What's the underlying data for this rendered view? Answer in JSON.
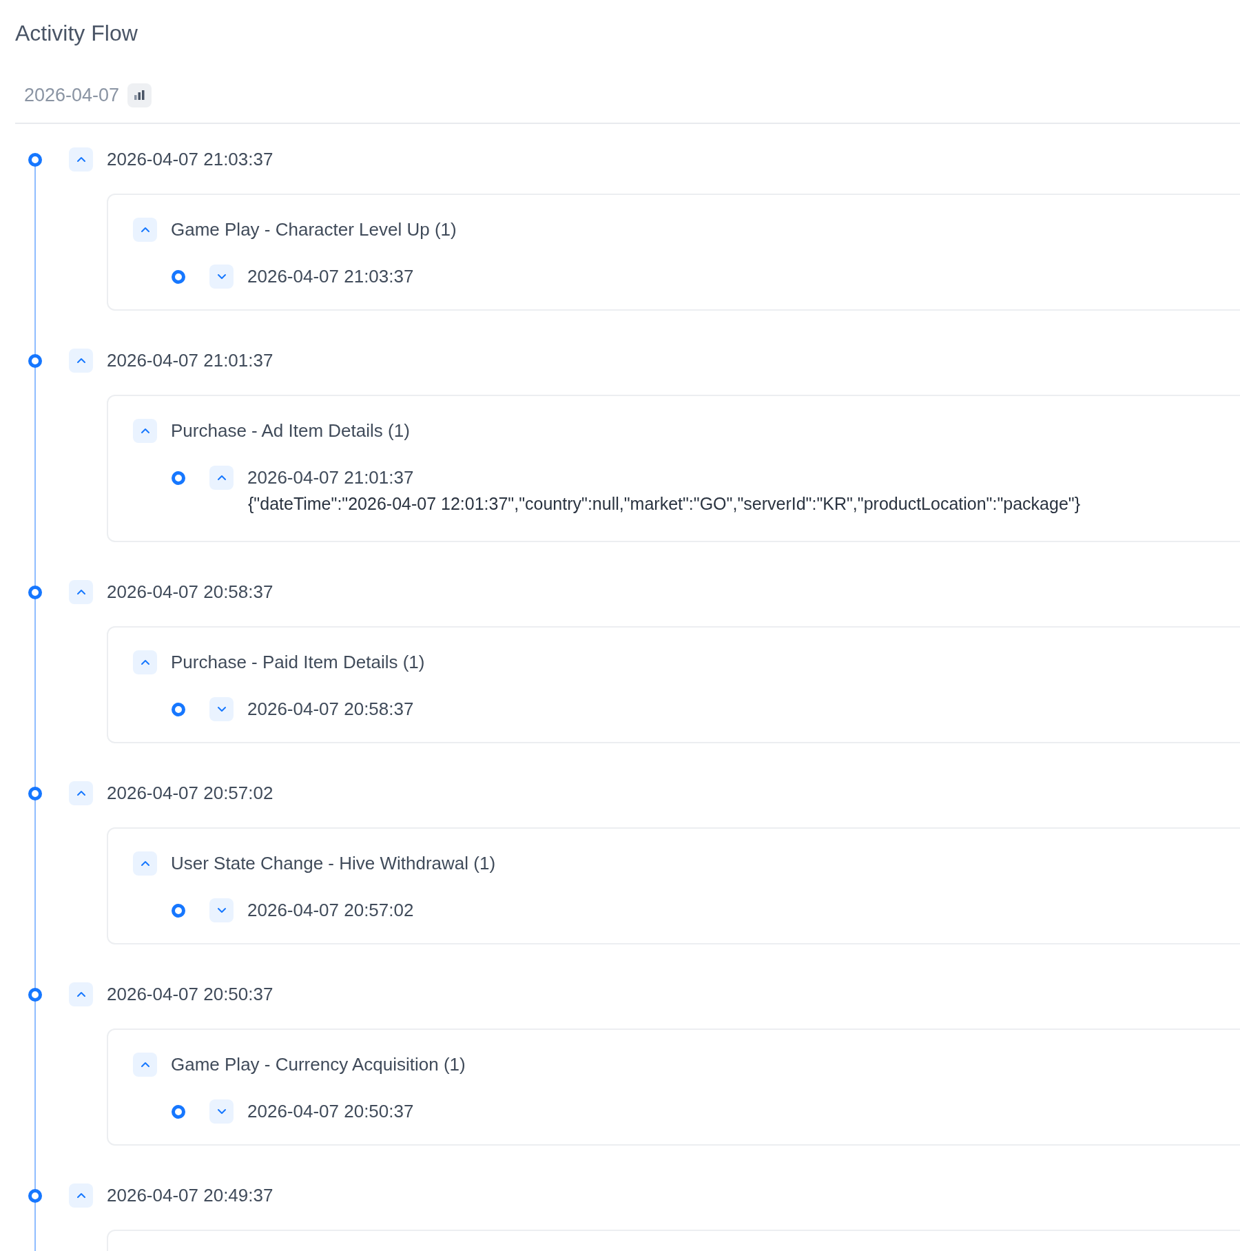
{
  "title": "Activity Flow",
  "date_tab": {
    "label": "2026-04-07"
  },
  "groups": [
    {
      "time": "2026-04-07 21:03:37",
      "expanded": true,
      "events": [
        {
          "name": "Game Play - Character Level Up (1)",
          "expanded": true,
          "entries": [
            {
              "time": "2026-04-07 21:03:37",
              "expanded": false
            }
          ]
        }
      ]
    },
    {
      "time": "2026-04-07 21:01:37",
      "expanded": true,
      "events": [
        {
          "name": "Purchase - Ad Item Details (1)",
          "expanded": true,
          "entries": [
            {
              "time": "2026-04-07 21:01:37",
              "expanded": true,
              "detail": "{\"dateTime\":\"2026-04-07 12:01:37\",\"country\":null,\"market\":\"GO\",\"serverId\":\"KR\",\"productLocation\":\"package\"}"
            }
          ]
        }
      ]
    },
    {
      "time": "2026-04-07 20:58:37",
      "expanded": true,
      "events": [
        {
          "name": "Purchase - Paid Item Details (1)",
          "expanded": true,
          "entries": [
            {
              "time": "2026-04-07 20:58:37",
              "expanded": false
            }
          ]
        }
      ]
    },
    {
      "time": "2026-04-07 20:57:02",
      "expanded": true,
      "events": [
        {
          "name": "User State Change - Hive Withdrawal (1)",
          "expanded": true,
          "entries": [
            {
              "time": "2026-04-07 20:57:02",
              "expanded": false
            }
          ]
        }
      ]
    },
    {
      "time": "2026-04-07 20:50:37",
      "expanded": true,
      "events": [
        {
          "name": "Game Play - Currency Acquisition (1)",
          "expanded": true,
          "entries": [
            {
              "time": "2026-04-07 20:50:37",
              "expanded": false
            }
          ]
        }
      ]
    },
    {
      "time": "2026-04-07 20:49:37",
      "expanded": true
    }
  ]
}
